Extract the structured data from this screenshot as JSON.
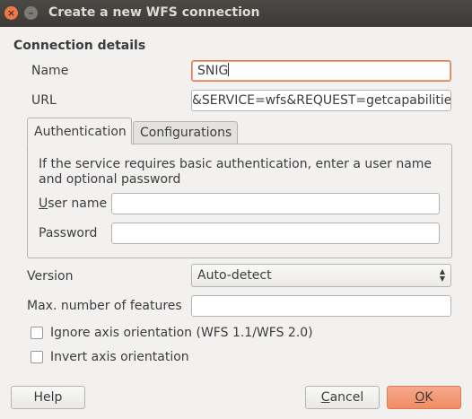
{
  "window": {
    "title": "Create a new WFS connection",
    "close_glyph": "×",
    "minimize_glyph": "–"
  },
  "connection": {
    "heading": "Connection details",
    "name_label": "Name",
    "name_value": "SNIG",
    "url_label": "URL",
    "url_value": "&SERVICE=wfs&REQUEST=getcapabilities"
  },
  "tabs": [
    {
      "label": "Authentication",
      "active": true
    },
    {
      "label": "Configurations",
      "active": false
    }
  ],
  "auth": {
    "description": "If the service requires basic authentication, enter a user name and optional password",
    "username_label_first": "U",
    "username_label_rest": "ser name",
    "username_value": "",
    "password_label": "Password",
    "password_value": ""
  },
  "version": {
    "label": "Version",
    "selected": "Auto-detect"
  },
  "max_features": {
    "label": "Max. number of features",
    "value": ""
  },
  "options": {
    "ignore_axis": "Ignore axis orientation (WFS 1.1/WFS 2.0)",
    "invert_axis": "Invert axis orientation"
  },
  "buttons": {
    "help": "Help",
    "cancel_first": "C",
    "cancel_rest": "ancel",
    "ok_first": "O",
    "ok_rest": "K"
  },
  "colors": {
    "accent": "#f08c64",
    "titlebar": "#3c3b37"
  }
}
